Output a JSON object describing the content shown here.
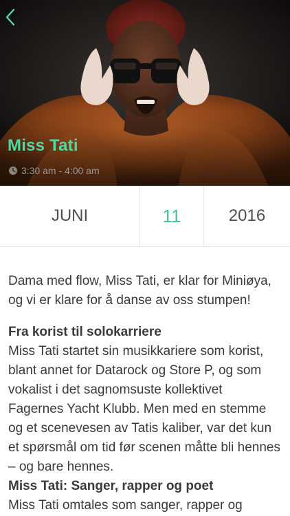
{
  "header": {
    "back_icon": "chevron-left-icon",
    "artist_name": "Miss Tati",
    "time_icon": "clock-icon",
    "time_range": "3:30 am - 4:00 am",
    "accent_color": "#4fd8a6"
  },
  "date": {
    "month": "JUNI",
    "day": "11",
    "year": "2016",
    "day_color": "#3fc79a"
  },
  "description": {
    "intro": "Dama med flow, Miss Tati, er klar for Miniøya, og vi er klare for å danse av oss stumpen!",
    "sections": [
      {
        "heading": "Fra korist til solokarriere",
        "text": "Miss Tati startet sin musikkariere som korist, blant annet for Datarock og Store P, og som vokalist i det sagnomsuste kollektivet Fagernes Yacht Klubb. Men med en stemme og et scenevesen av Tatis kaliber, var det kun et spørsmål om tid før scenen måtte bli hennes – og bare hennes."
      },
      {
        "heading": "Miss Tati: Sanger, rapper og poet",
        "text": "Miss Tati omtales som sanger, rapper og"
      }
    ]
  }
}
